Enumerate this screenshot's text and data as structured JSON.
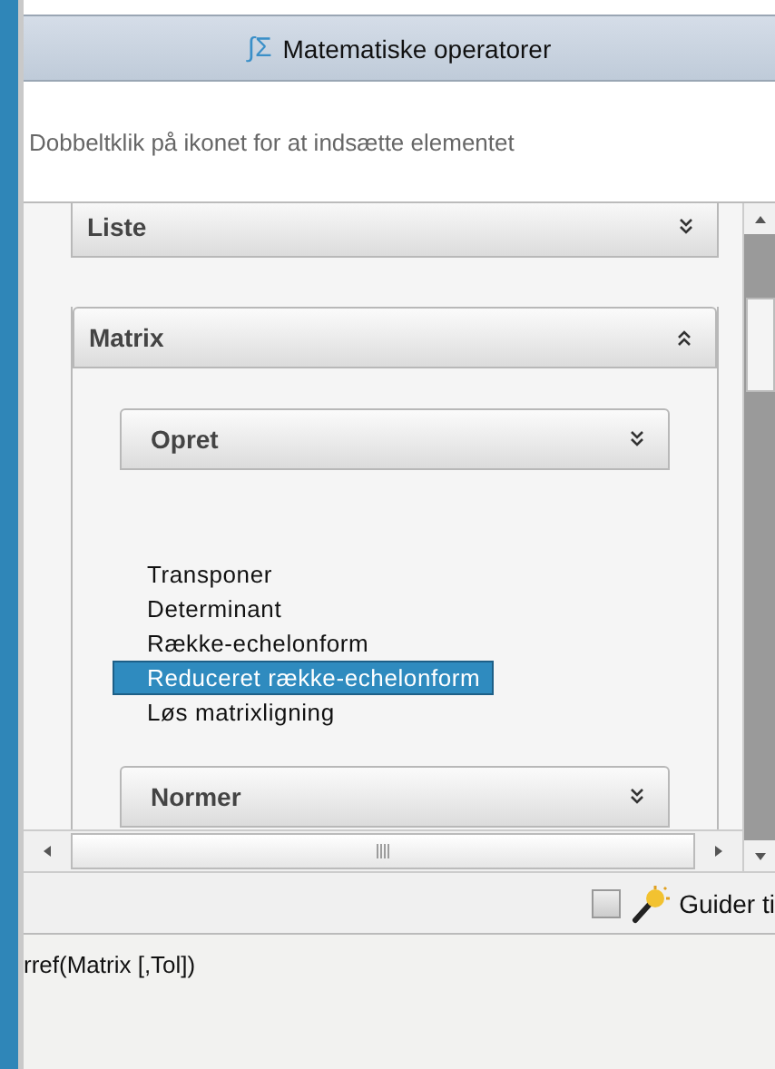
{
  "window": {
    "title_icon": "∫Σ",
    "title": "Matematiske operatorer"
  },
  "hint": "Dobbeltklik på ikonet for at indsætte elementet",
  "sections": [
    {
      "title": "Liste",
      "expanded": false
    },
    {
      "title": "Matrix",
      "expanded": true,
      "groups": [
        {
          "title": "Opret",
          "expanded": false,
          "items": [
            {
              "label": "Transponer",
              "selected": false
            },
            {
              "label": "Determinant",
              "selected": false
            },
            {
              "label": "Række-echelonform",
              "selected": false
            },
            {
              "label": "Reduceret række-echelonform",
              "selected": true
            },
            {
              "label": "Løs matrixligning",
              "selected": false
            }
          ]
        },
        {
          "title": "Normer",
          "expanded": false
        }
      ]
    }
  ],
  "wizard": {
    "label": "Guider ti",
    "checked": false
  },
  "syntax": "rref(Matrix [,Tol])"
}
